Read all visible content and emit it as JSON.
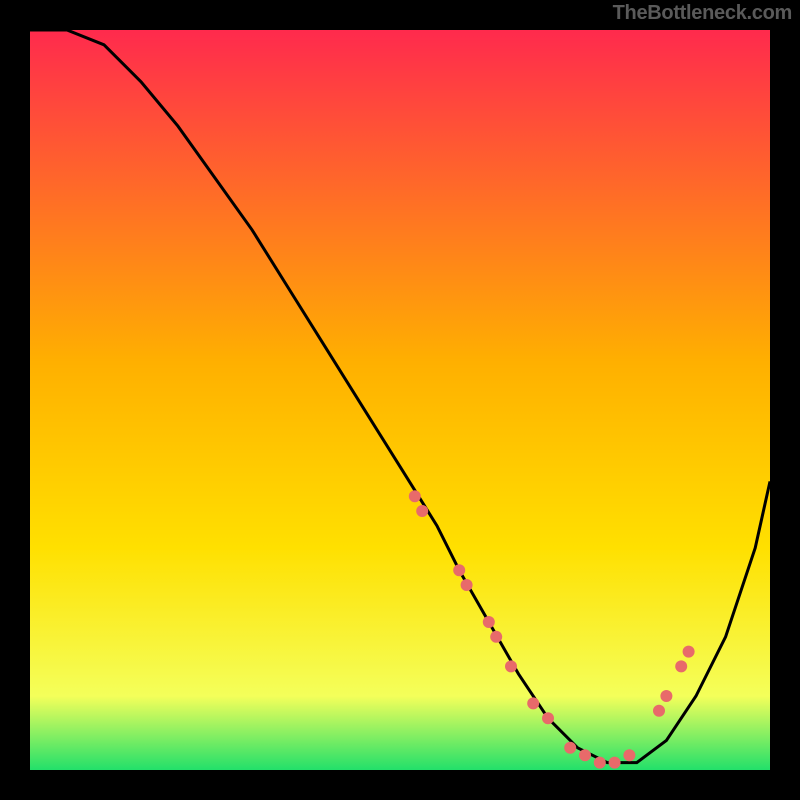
{
  "attribution": "TheBottleneck.com",
  "colors": {
    "background": "#000000",
    "gradient_top": "#ff2a4d",
    "gradient_mid": "#ffd400",
    "gradient_bottom": "#22e06a",
    "curve": "#000000",
    "marker": "#e86a6a"
  },
  "chart_data": {
    "type": "line",
    "title": "",
    "xlabel": "",
    "ylabel": "",
    "xlim": [
      0,
      100
    ],
    "ylim": [
      0,
      100
    ],
    "series": [
      {
        "name": "bottleneck-curve",
        "x": [
          0,
          5,
          10,
          15,
          20,
          25,
          30,
          35,
          40,
          45,
          50,
          55,
          58,
          62,
          66,
          70,
          74,
          78,
          82,
          86,
          90,
          94,
          98,
          100
        ],
        "y": [
          100,
          100,
          98,
          93,
          87,
          80,
          73,
          65,
          57,
          49,
          41,
          33,
          27,
          20,
          13,
          7,
          3,
          1,
          1,
          4,
          10,
          18,
          30,
          39
        ]
      }
    ],
    "markers": {
      "name": "highlighted-points",
      "x": [
        52,
        53,
        58,
        59,
        62,
        63,
        65,
        68,
        70,
        73,
        75,
        77,
        79,
        81,
        85,
        86,
        88,
        89
      ],
      "y": [
        37,
        35,
        27,
        25,
        20,
        18,
        14,
        9,
        7,
        3,
        2,
        1,
        1,
        2,
        8,
        10,
        14,
        16
      ]
    }
  }
}
